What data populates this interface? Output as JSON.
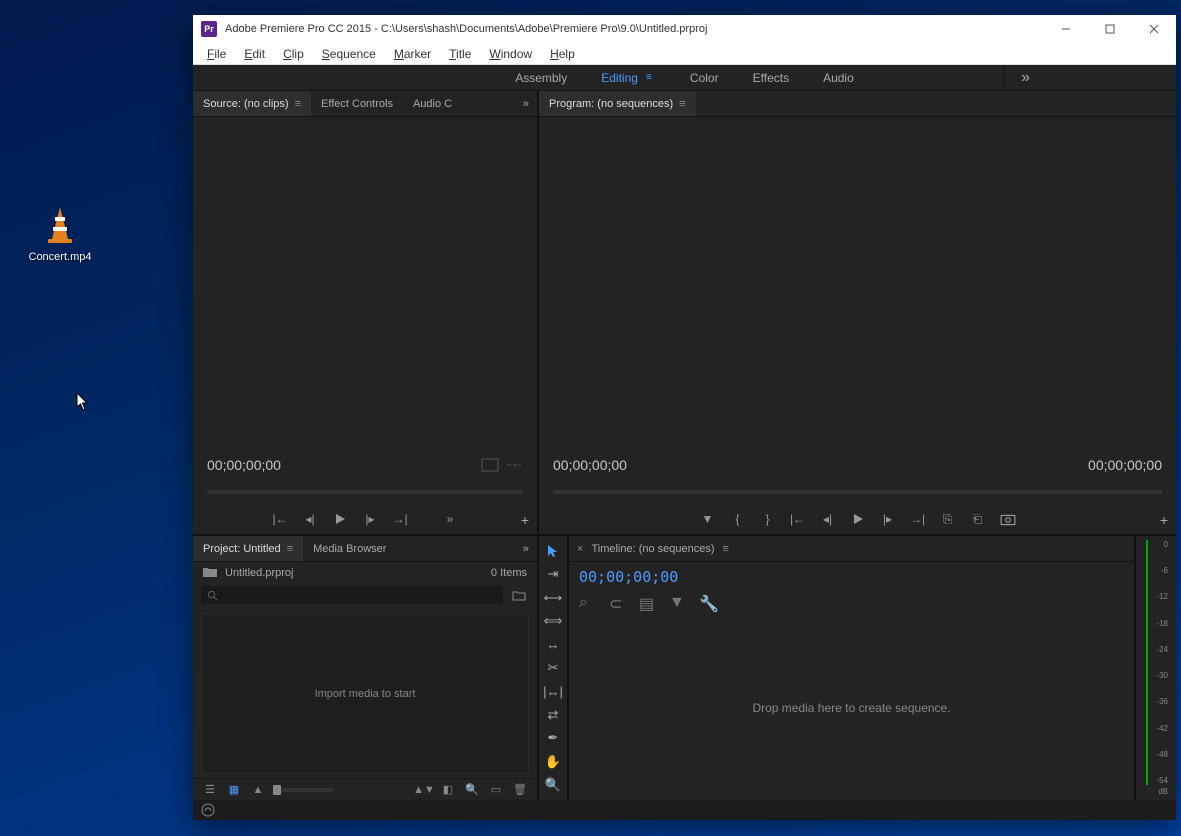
{
  "desktop": {
    "file_label": "Concert.mp4"
  },
  "app": {
    "icon_text": "Pr",
    "title": "Adobe Premiere Pro CC 2015 - C:\\Users\\shash\\Documents\\Adobe\\Premiere Pro\\9.0\\Untitled.prproj"
  },
  "menu": {
    "file": "File",
    "edit": "Edit",
    "clip": "Clip",
    "sequence": "Sequence",
    "marker": "Marker",
    "title": "Title",
    "window": "Window",
    "help": "Help"
  },
  "workspaces": {
    "assembly": "Assembly",
    "editing": "Editing",
    "color": "Color",
    "effects": "Effects",
    "audio": "Audio"
  },
  "source": {
    "tab_label": "Source: (no clips)",
    "effect_controls": "Effect Controls",
    "audio_clip": "Audio C",
    "timecode": "00;00;00;00"
  },
  "program": {
    "tab_label": "Program: (no sequences)",
    "timecode_left": "00;00;00;00",
    "timecode_right": "00;00;00;00"
  },
  "project": {
    "tab_label": "Project: Untitled",
    "media_browser": "Media Browser",
    "filename": "Untitled.prproj",
    "item_count": "0 Items",
    "drop_hint": "Import media to start"
  },
  "timeline": {
    "tab_label": "Timeline: (no sequences)",
    "timecode": "00;00;00;00",
    "drop_hint": "Drop media here to create sequence."
  },
  "meter": {
    "marks": [
      "0",
      "-6",
      "-12",
      "-18",
      "-24",
      "-30",
      "-36",
      "-42",
      "-48",
      "-54"
    ],
    "unit": "dB"
  }
}
